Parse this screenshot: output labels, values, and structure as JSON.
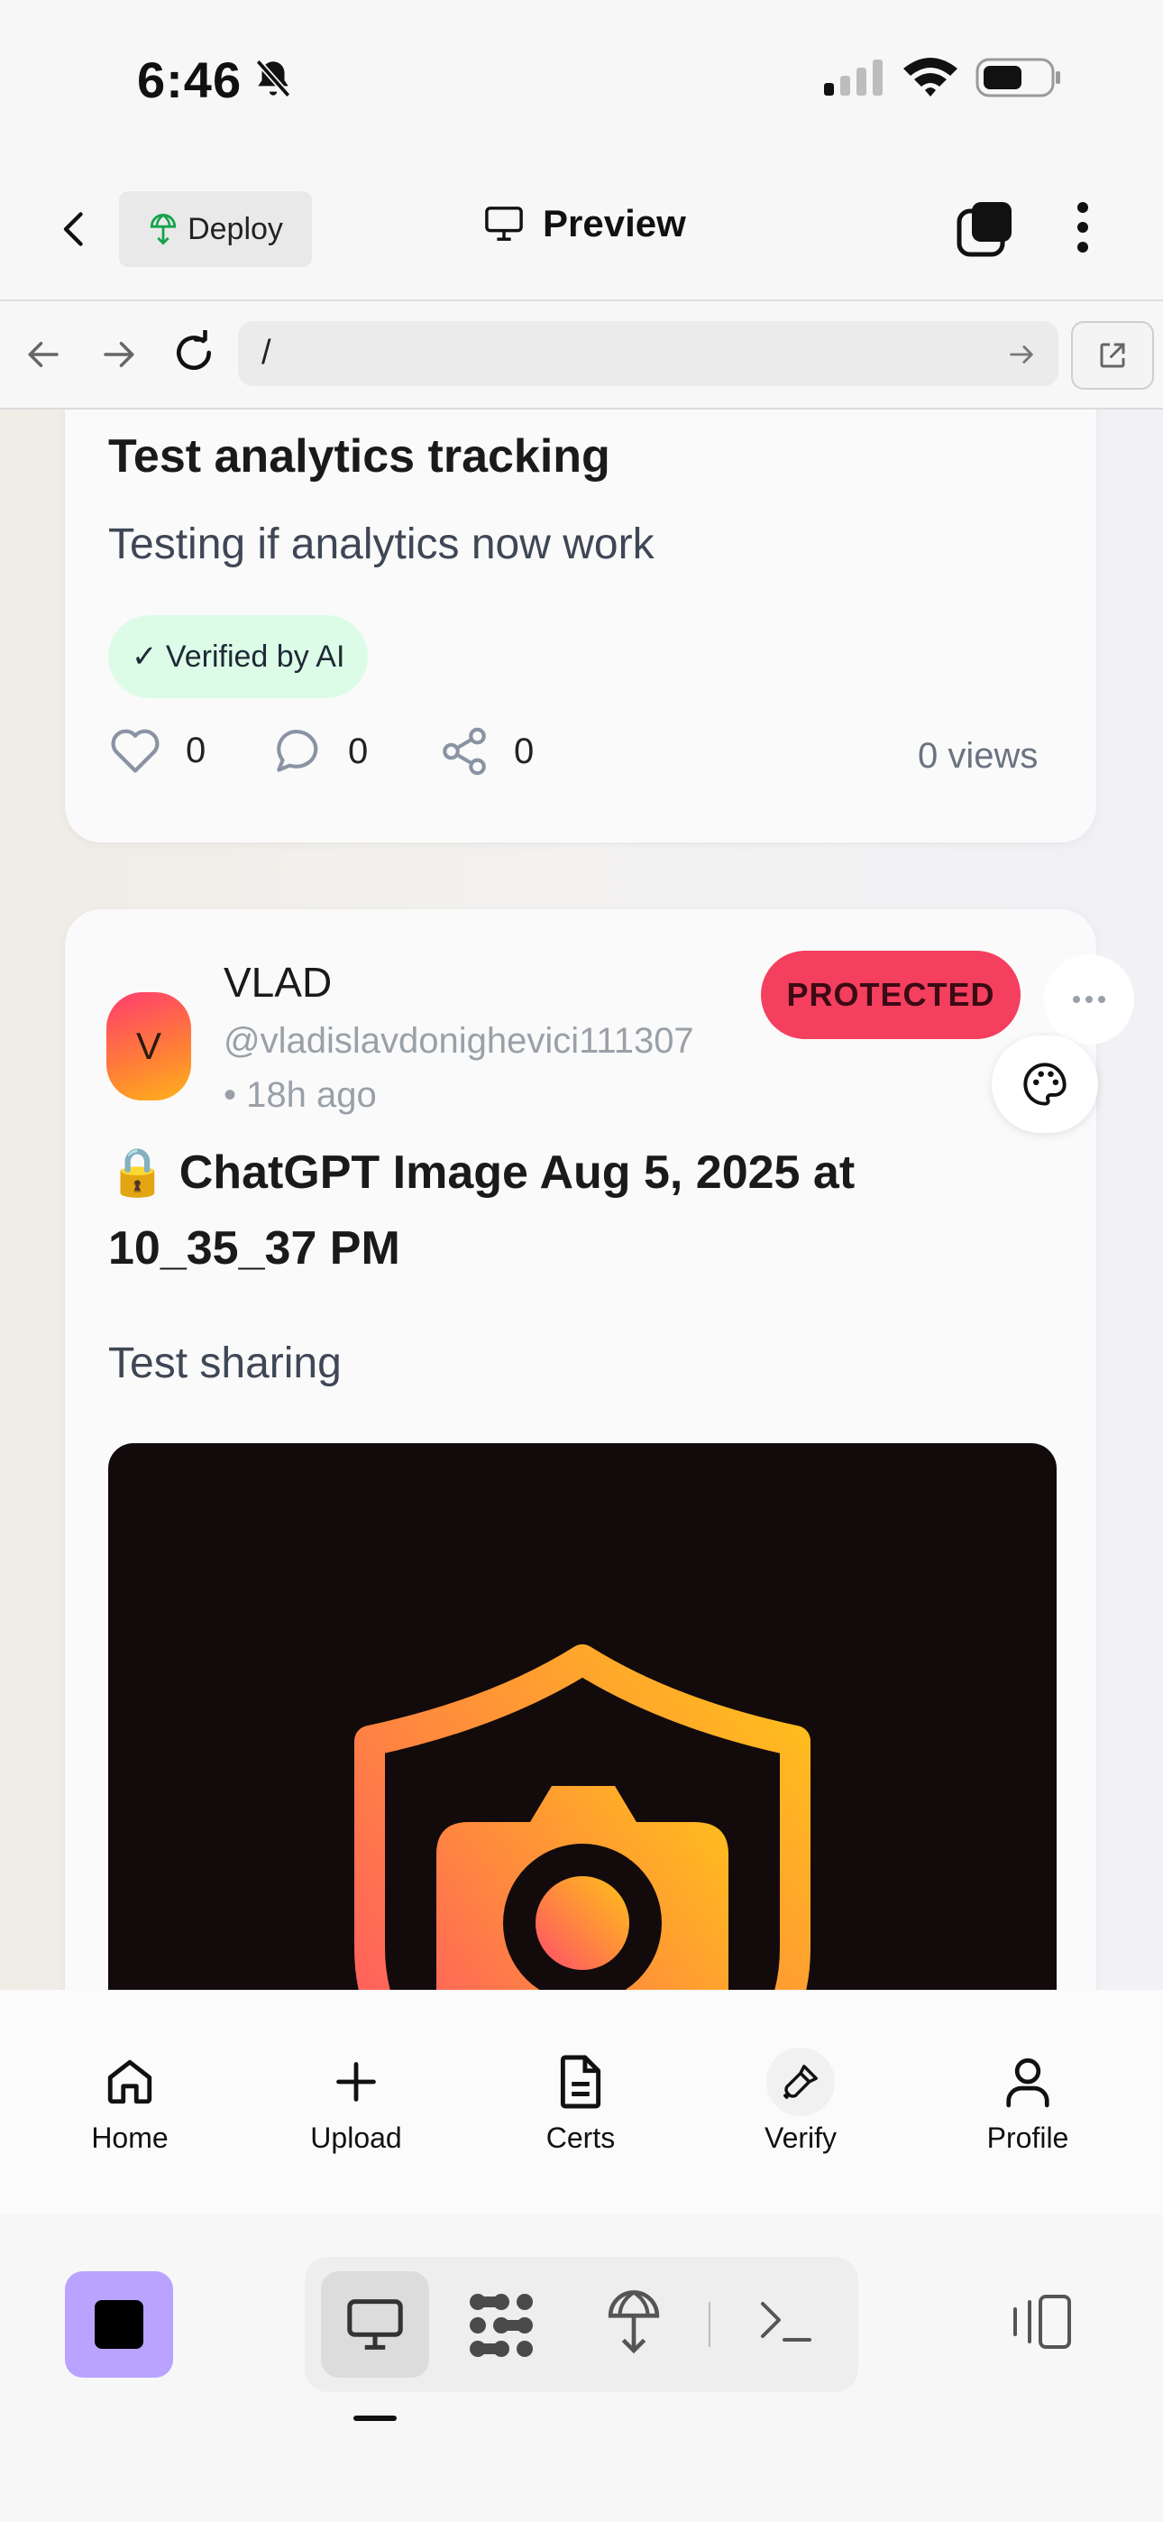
{
  "status_bar": {
    "time": "6:46"
  },
  "header": {
    "back_label": "",
    "deploy_label": "Deploy",
    "title": "Preview"
  },
  "browser": {
    "url": "/"
  },
  "posts": [
    {
      "title": "Test analytics tracking",
      "description": "Testing if analytics now work",
      "badge": "✓ Verified by AI",
      "likes": "0",
      "comments": "0",
      "shares": "0",
      "views": "0 views"
    },
    {
      "avatar_letter": "V",
      "author": "VLAD",
      "handle": "@vladislavdonighevici111307",
      "time": "• 18h ago",
      "status": "PROTECTED",
      "title_icon": "🔒",
      "title": "ChatGPT Image Aug 5, 2025 at 10_35_37 PM",
      "description": "Test sharing"
    }
  ],
  "bottom_nav": [
    {
      "label": "Home",
      "icon": "home-icon"
    },
    {
      "label": "Upload",
      "icon": "plus-icon"
    },
    {
      "label": "Certs",
      "icon": "document-icon"
    },
    {
      "label": "Verify",
      "icon": "brush-icon"
    },
    {
      "label": "Profile",
      "icon": "user-icon"
    }
  ],
  "colors": {
    "protected": "#f43f5e",
    "verified_bg": "#dcfce7",
    "stop_button": "#b9a3ff"
  }
}
